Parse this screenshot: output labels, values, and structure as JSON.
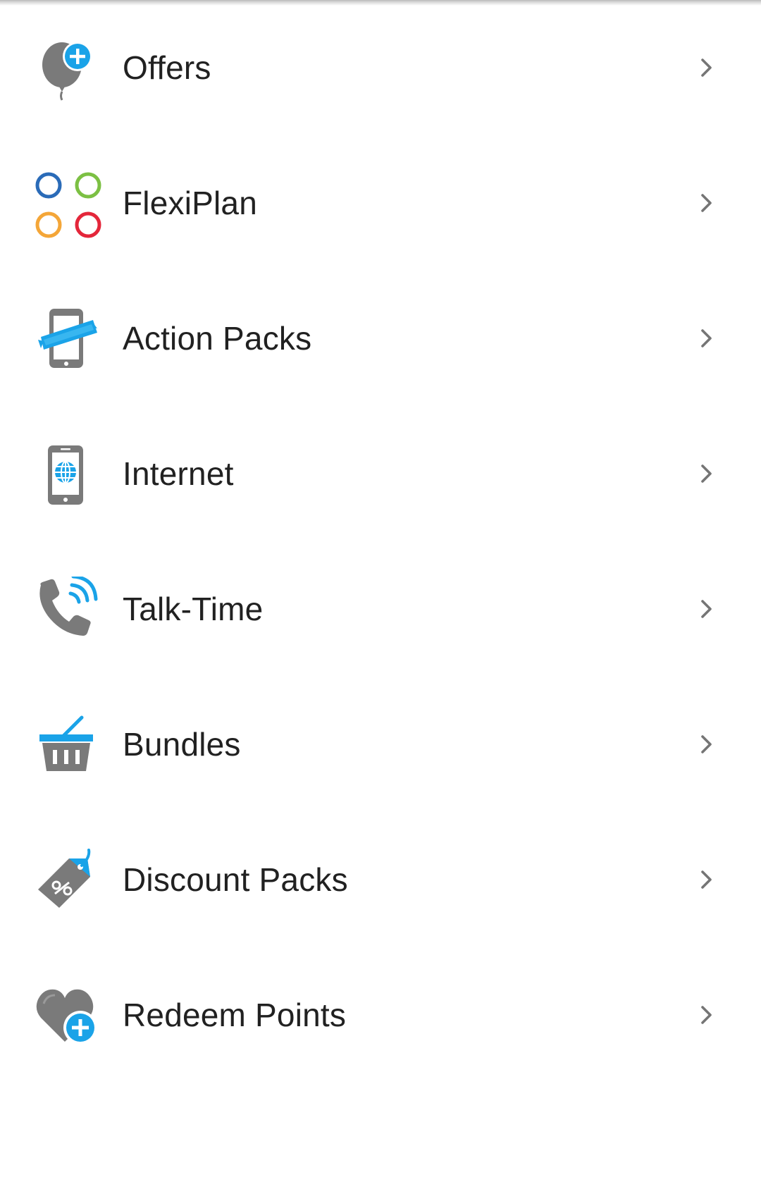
{
  "colors": {
    "icon_gray": "#7a7a7a",
    "accent_blue": "#1aa3e8",
    "text": "#212121",
    "chevron": "#757575",
    "flexi_blue": "#2a6bb8",
    "flexi_green": "#7cc043",
    "flexi_orange": "#f4a638",
    "flexi_red": "#e4263a"
  },
  "menu": {
    "items": [
      {
        "label": "Offers",
        "icon": "balloon-plus-icon"
      },
      {
        "label": "FlexiPlan",
        "icon": "four-circles-icon"
      },
      {
        "label": "Action Packs",
        "icon": "phone-ribbon-icon"
      },
      {
        "label": "Internet",
        "icon": "phone-globe-icon"
      },
      {
        "label": "Talk-Time",
        "icon": "phone-signal-icon"
      },
      {
        "label": "Bundles",
        "icon": "basket-icon"
      },
      {
        "label": "Discount Packs",
        "icon": "discount-tag-icon"
      },
      {
        "label": "Redeem Points",
        "icon": "heart-plus-icon"
      }
    ]
  }
}
